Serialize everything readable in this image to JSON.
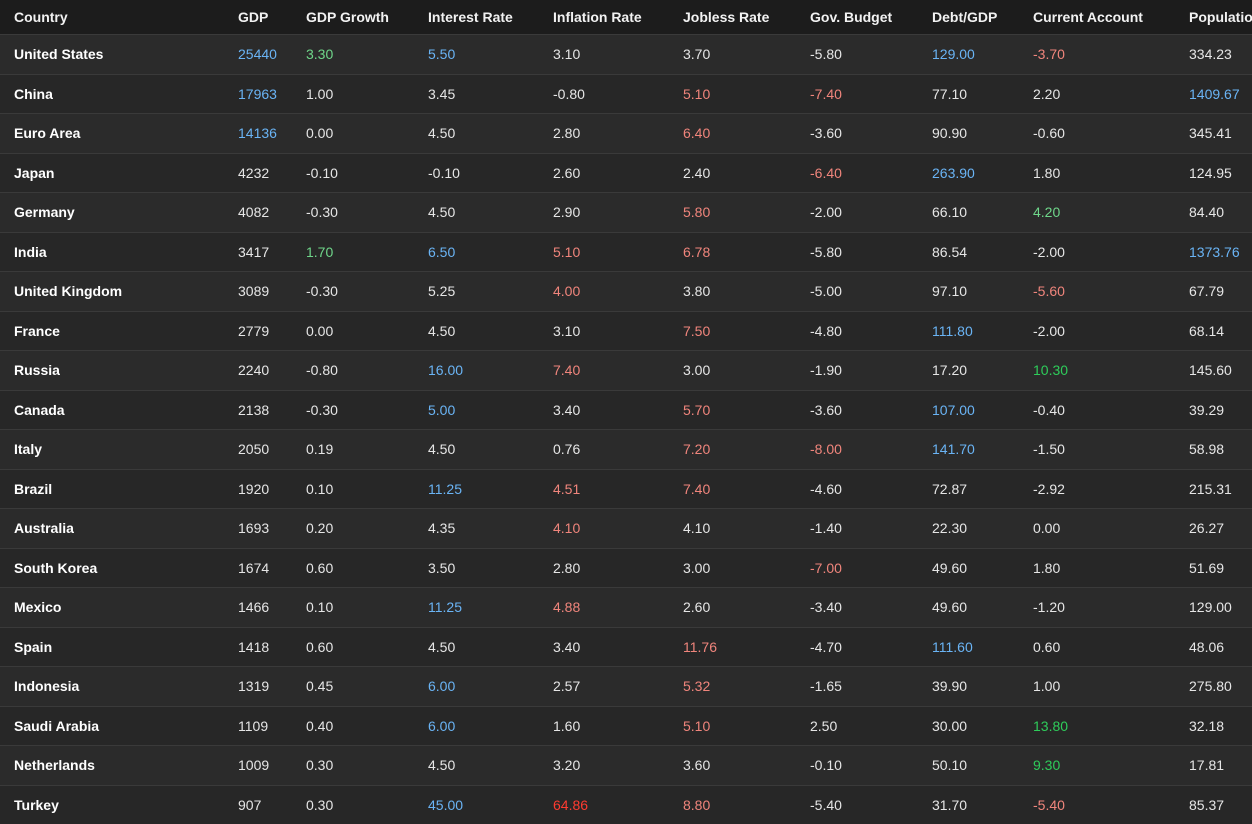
{
  "headers": [
    "Country",
    "GDP",
    "GDP Growth",
    "Interest Rate",
    "Inflation Rate",
    "Jobless Rate",
    "Gov. Budget",
    "Debt/GDP",
    "Current Account",
    "Population"
  ],
  "colors": {
    "blue": "#6ab4f5",
    "green": "#6fd68a",
    "green_strong": "#2ecc5a",
    "red": "#f0857c",
    "red_strong": "#ff3b30",
    "normal": "#e6e6e6"
  },
  "rows": [
    {
      "cells": [
        "United States",
        "25440",
        "3.30",
        "5.50",
        "3.10",
        "3.70",
        "-5.80",
        "129.00",
        "-3.70",
        "334.23"
      ],
      "colors": [
        "",
        "blue",
        "green",
        "blue",
        "",
        "",
        "",
        "blue",
        "red",
        ""
      ]
    },
    {
      "cells": [
        "China",
        "17963",
        "1.00",
        "3.45",
        "-0.80",
        "5.10",
        "-7.40",
        "77.10",
        "2.20",
        "1409.67"
      ],
      "colors": [
        "",
        "blue",
        "",
        "",
        "",
        "red",
        "red",
        "",
        "",
        "blue"
      ]
    },
    {
      "cells": [
        "Euro Area",
        "14136",
        "0.00",
        "4.50",
        "2.80",
        "6.40",
        "-3.60",
        "90.90",
        "-0.60",
        "345.41"
      ],
      "colors": [
        "",
        "blue",
        "",
        "",
        "",
        "red",
        "",
        "",
        "",
        ""
      ]
    },
    {
      "cells": [
        "Japan",
        "4232",
        "-0.10",
        "-0.10",
        "2.60",
        "2.40",
        "-6.40",
        "263.90",
        "1.80",
        "124.95"
      ],
      "colors": [
        "",
        "",
        "",
        "",
        "",
        "",
        "red",
        "blue",
        "",
        ""
      ]
    },
    {
      "cells": [
        "Germany",
        "4082",
        "-0.30",
        "4.50",
        "2.90",
        "5.80",
        "-2.00",
        "66.10",
        "4.20",
        "84.40"
      ],
      "colors": [
        "",
        "",
        "",
        "",
        "",
        "red",
        "",
        "",
        "green",
        ""
      ]
    },
    {
      "cells": [
        "India",
        "3417",
        "1.70",
        "6.50",
        "5.10",
        "6.78",
        "-5.80",
        "86.54",
        "-2.00",
        "1373.76"
      ],
      "colors": [
        "",
        "",
        "green",
        "blue",
        "red",
        "red",
        "",
        "",
        "",
        "blue"
      ]
    },
    {
      "cells": [
        "United Kingdom",
        "3089",
        "-0.30",
        "5.25",
        "4.00",
        "3.80",
        "-5.00",
        "97.10",
        "-5.60",
        "67.79"
      ],
      "colors": [
        "",
        "",
        "",
        "",
        "red",
        "",
        "",
        "",
        "red",
        ""
      ]
    },
    {
      "cells": [
        "France",
        "2779",
        "0.00",
        "4.50",
        "3.10",
        "7.50",
        "-4.80",
        "111.80",
        "-2.00",
        "68.14"
      ],
      "colors": [
        "",
        "",
        "",
        "",
        "",
        "red",
        "",
        "blue",
        "",
        ""
      ]
    },
    {
      "cells": [
        "Russia",
        "2240",
        "-0.80",
        "16.00",
        "7.40",
        "3.00",
        "-1.90",
        "17.20",
        "10.30",
        "145.60"
      ],
      "colors": [
        "",
        "",
        "",
        "blue",
        "red",
        "",
        "",
        "",
        "green_strong",
        ""
      ]
    },
    {
      "cells": [
        "Canada",
        "2138",
        "-0.30",
        "5.00",
        "3.40",
        "5.70",
        "-3.60",
        "107.00",
        "-0.40",
        "39.29"
      ],
      "colors": [
        "",
        "",
        "",
        "blue",
        "",
        "red",
        "",
        "blue",
        "",
        ""
      ]
    },
    {
      "cells": [
        "Italy",
        "2050",
        "0.19",
        "4.50",
        "0.76",
        "7.20",
        "-8.00",
        "141.70",
        "-1.50",
        "58.98"
      ],
      "colors": [
        "",
        "",
        "",
        "",
        "",
        "red",
        "red",
        "blue",
        "",
        ""
      ]
    },
    {
      "cells": [
        "Brazil",
        "1920",
        "0.10",
        "11.25",
        "4.51",
        "7.40",
        "-4.60",
        "72.87",
        "-2.92",
        "215.31"
      ],
      "colors": [
        "",
        "",
        "",
        "blue",
        "red",
        "red",
        "",
        "",
        "",
        ""
      ]
    },
    {
      "cells": [
        "Australia",
        "1693",
        "0.20",
        "4.35",
        "4.10",
        "4.10",
        "-1.40",
        "22.30",
        "0.00",
        "26.27"
      ],
      "colors": [
        "",
        "",
        "",
        "",
        "red",
        "",
        "",
        "",
        "",
        ""
      ]
    },
    {
      "cells": [
        "South Korea",
        "1674",
        "0.60",
        "3.50",
        "2.80",
        "3.00",
        "-7.00",
        "49.60",
        "1.80",
        "51.69"
      ],
      "colors": [
        "",
        "",
        "",
        "",
        "",
        "",
        "red",
        "",
        "",
        ""
      ]
    },
    {
      "cells": [
        "Mexico",
        "1466",
        "0.10",
        "11.25",
        "4.88",
        "2.60",
        "-3.40",
        "49.60",
        "-1.20",
        "129.00"
      ],
      "colors": [
        "",
        "",
        "",
        "blue",
        "red",
        "",
        "",
        "",
        "",
        ""
      ]
    },
    {
      "cells": [
        "Spain",
        "1418",
        "0.60",
        "4.50",
        "3.40",
        "11.76",
        "-4.70",
        "111.60",
        "0.60",
        "48.06"
      ],
      "colors": [
        "",
        "",
        "",
        "",
        "",
        "red",
        "",
        "blue",
        "",
        ""
      ]
    },
    {
      "cells": [
        "Indonesia",
        "1319",
        "0.45",
        "6.00",
        "2.57",
        "5.32",
        "-1.65",
        "39.90",
        "1.00",
        "275.80"
      ],
      "colors": [
        "",
        "",
        "",
        "blue",
        "",
        "red",
        "",
        "",
        "",
        ""
      ]
    },
    {
      "cells": [
        "Saudi Arabia",
        "1109",
        "0.40",
        "6.00",
        "1.60",
        "5.10",
        "2.50",
        "30.00",
        "13.80",
        "32.18"
      ],
      "colors": [
        "",
        "",
        "",
        "blue",
        "",
        "red",
        "",
        "",
        "green_strong",
        ""
      ]
    },
    {
      "cells": [
        "Netherlands",
        "1009",
        "0.30",
        "4.50",
        "3.20",
        "3.60",
        "-0.10",
        "50.10",
        "9.30",
        "17.81"
      ],
      "colors": [
        "",
        "",
        "",
        "",
        "",
        "",
        "",
        "",
        "green_strong",
        ""
      ]
    },
    {
      "cells": [
        "Turkey",
        "907",
        "0.30",
        "45.00",
        "64.86",
        "8.80",
        "-5.40",
        "31.70",
        "-5.40",
        "85.37"
      ],
      "colors": [
        "",
        "",
        "",
        "blue",
        "red_strong",
        "red",
        "",
        "",
        "red",
        ""
      ]
    }
  ]
}
